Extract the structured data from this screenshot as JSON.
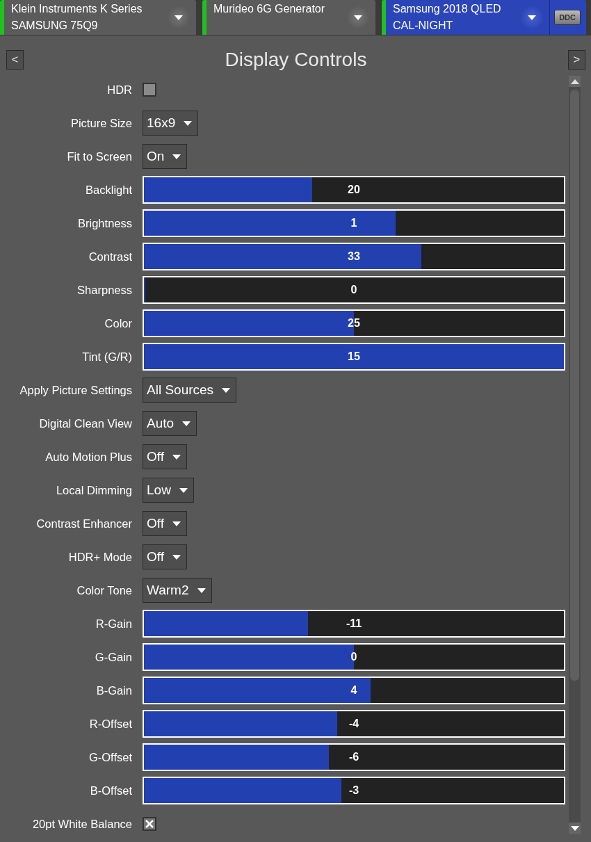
{
  "tabs": [
    {
      "title": "Klein Instruments K Series",
      "subtitle": "SAMSUNG 75Q9",
      "selected": false
    },
    {
      "title": "Murideo 6G Generator",
      "selected": false
    },
    {
      "title": "Samsung 2018 QLED",
      "subtitle": "CAL-NIGHT",
      "selected": true,
      "badge": "DDC"
    }
  ],
  "panel": {
    "title": "Display Controls",
    "prev": "<",
    "next": ">"
  },
  "controls": [
    {
      "kind": "checkbox",
      "label": "HDR",
      "checked": false
    },
    {
      "kind": "dropdown",
      "label": "Picture Size",
      "value": "16x9"
    },
    {
      "kind": "dropdown",
      "label": "Fit to Screen",
      "value": "On"
    },
    {
      "kind": "slider",
      "label": "Backlight",
      "value": "20",
      "level": 0.4
    },
    {
      "kind": "slider",
      "label": "Brightness",
      "value": "1",
      "level": 0.6
    },
    {
      "kind": "slider",
      "label": "Contrast",
      "value": "33",
      "level": 0.66
    },
    {
      "kind": "slider",
      "label": "Sharpness",
      "value": "0",
      "level": 0
    },
    {
      "kind": "slider",
      "label": "Color",
      "value": "25",
      "level": 0.5
    },
    {
      "kind": "slider",
      "label": "Tint (G/R)",
      "value": "15",
      "level": 1
    },
    {
      "kind": "dropdown",
      "label": "Apply Picture Settings",
      "value": "All Sources"
    },
    {
      "kind": "dropdown",
      "label": "Digital Clean View",
      "value": "Auto"
    },
    {
      "kind": "dropdown",
      "label": "Auto Motion Plus",
      "value": "Off"
    },
    {
      "kind": "dropdown",
      "label": "Local Dimming",
      "value": "Low"
    },
    {
      "kind": "dropdown",
      "label": "Contrast Enhancer",
      "value": "Off"
    },
    {
      "kind": "dropdown",
      "label": "HDR+ Mode",
      "value": "Off"
    },
    {
      "kind": "dropdown",
      "label": "Color Tone",
      "value": "Warm2"
    },
    {
      "kind": "slider",
      "label": "R-Gain",
      "value": "-11",
      "level": 0.39
    },
    {
      "kind": "slider",
      "label": "G-Gain",
      "value": "0",
      "level": 0.5
    },
    {
      "kind": "slider",
      "label": "B-Gain",
      "value": "4",
      "level": 0.54
    },
    {
      "kind": "slider",
      "label": "R-Offset",
      "value": "-4",
      "level": 0.46
    },
    {
      "kind": "slider",
      "label": "G-Offset",
      "value": "-6",
      "level": 0.44
    },
    {
      "kind": "slider",
      "label": "B-Offset",
      "value": "-3",
      "level": 0.47
    },
    {
      "kind": "checkbox",
      "label": "20pt White Balance",
      "checked": true
    }
  ]
}
